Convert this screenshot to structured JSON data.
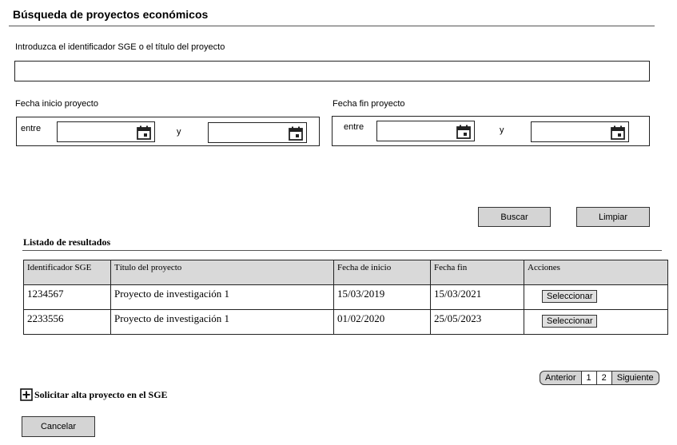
{
  "header": {
    "title": "Búsqueda de proyectos económicos"
  },
  "search": {
    "label": "Introduzca el identificador SGE o el título del proyecto",
    "value": "",
    "placeholder": ""
  },
  "start_date": {
    "label": "Fecha inicio proyecto",
    "between": "entre",
    "and": "y",
    "from_value": "",
    "to_value": ""
  },
  "end_date": {
    "label": "Fecha fin proyecto",
    "between": "entre",
    "and": "y",
    "from_value": "",
    "to_value": ""
  },
  "actions": {
    "search_label": "Buscar",
    "clear_label": "Limpiar"
  },
  "results": {
    "title": "Listado de resultados",
    "columns": [
      "Identificador SGE",
      "Título del proyecto",
      "Fecha de inicio",
      "Fecha fin",
      "Acciones"
    ],
    "rows": [
      {
        "id": "1234567",
        "title": "Proyecto de investigación 1",
        "start": "15/03/2019",
        "end": "15/03/2021",
        "action": "Seleccionar"
      },
      {
        "id": "2233556",
        "title": "Proyecto de investigación 1",
        "start": "01/02/2020",
        "end": "25/05/2023",
        "action": "Seleccionar"
      }
    ]
  },
  "pagination": {
    "previous": "Anterior",
    "pages": [
      "1",
      "2"
    ],
    "next": "Siguiente"
  },
  "request": {
    "label": "Solicitar alta proyecto en el SGE",
    "icon": "plus-box-icon"
  },
  "footer": {
    "cancel_label": "Cancelar"
  }
}
